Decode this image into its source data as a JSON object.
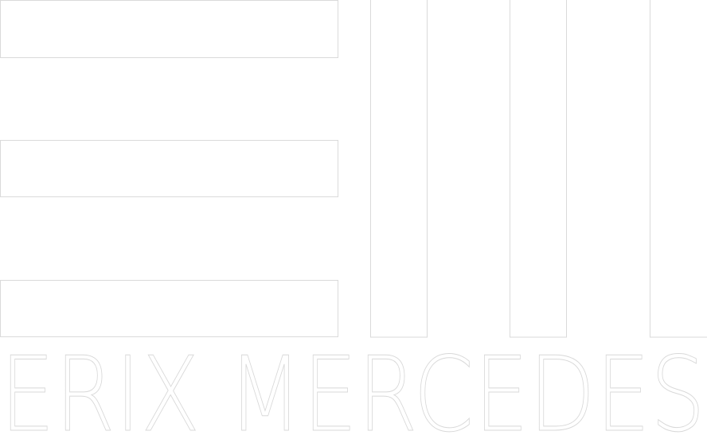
{
  "logo": {
    "wordmark": "ERIX MERCEDES",
    "mark": "horizontal-bars-and-vertical-columns",
    "colors": {
      "fill": "#ffffff",
      "outline": "#dadada"
    }
  }
}
